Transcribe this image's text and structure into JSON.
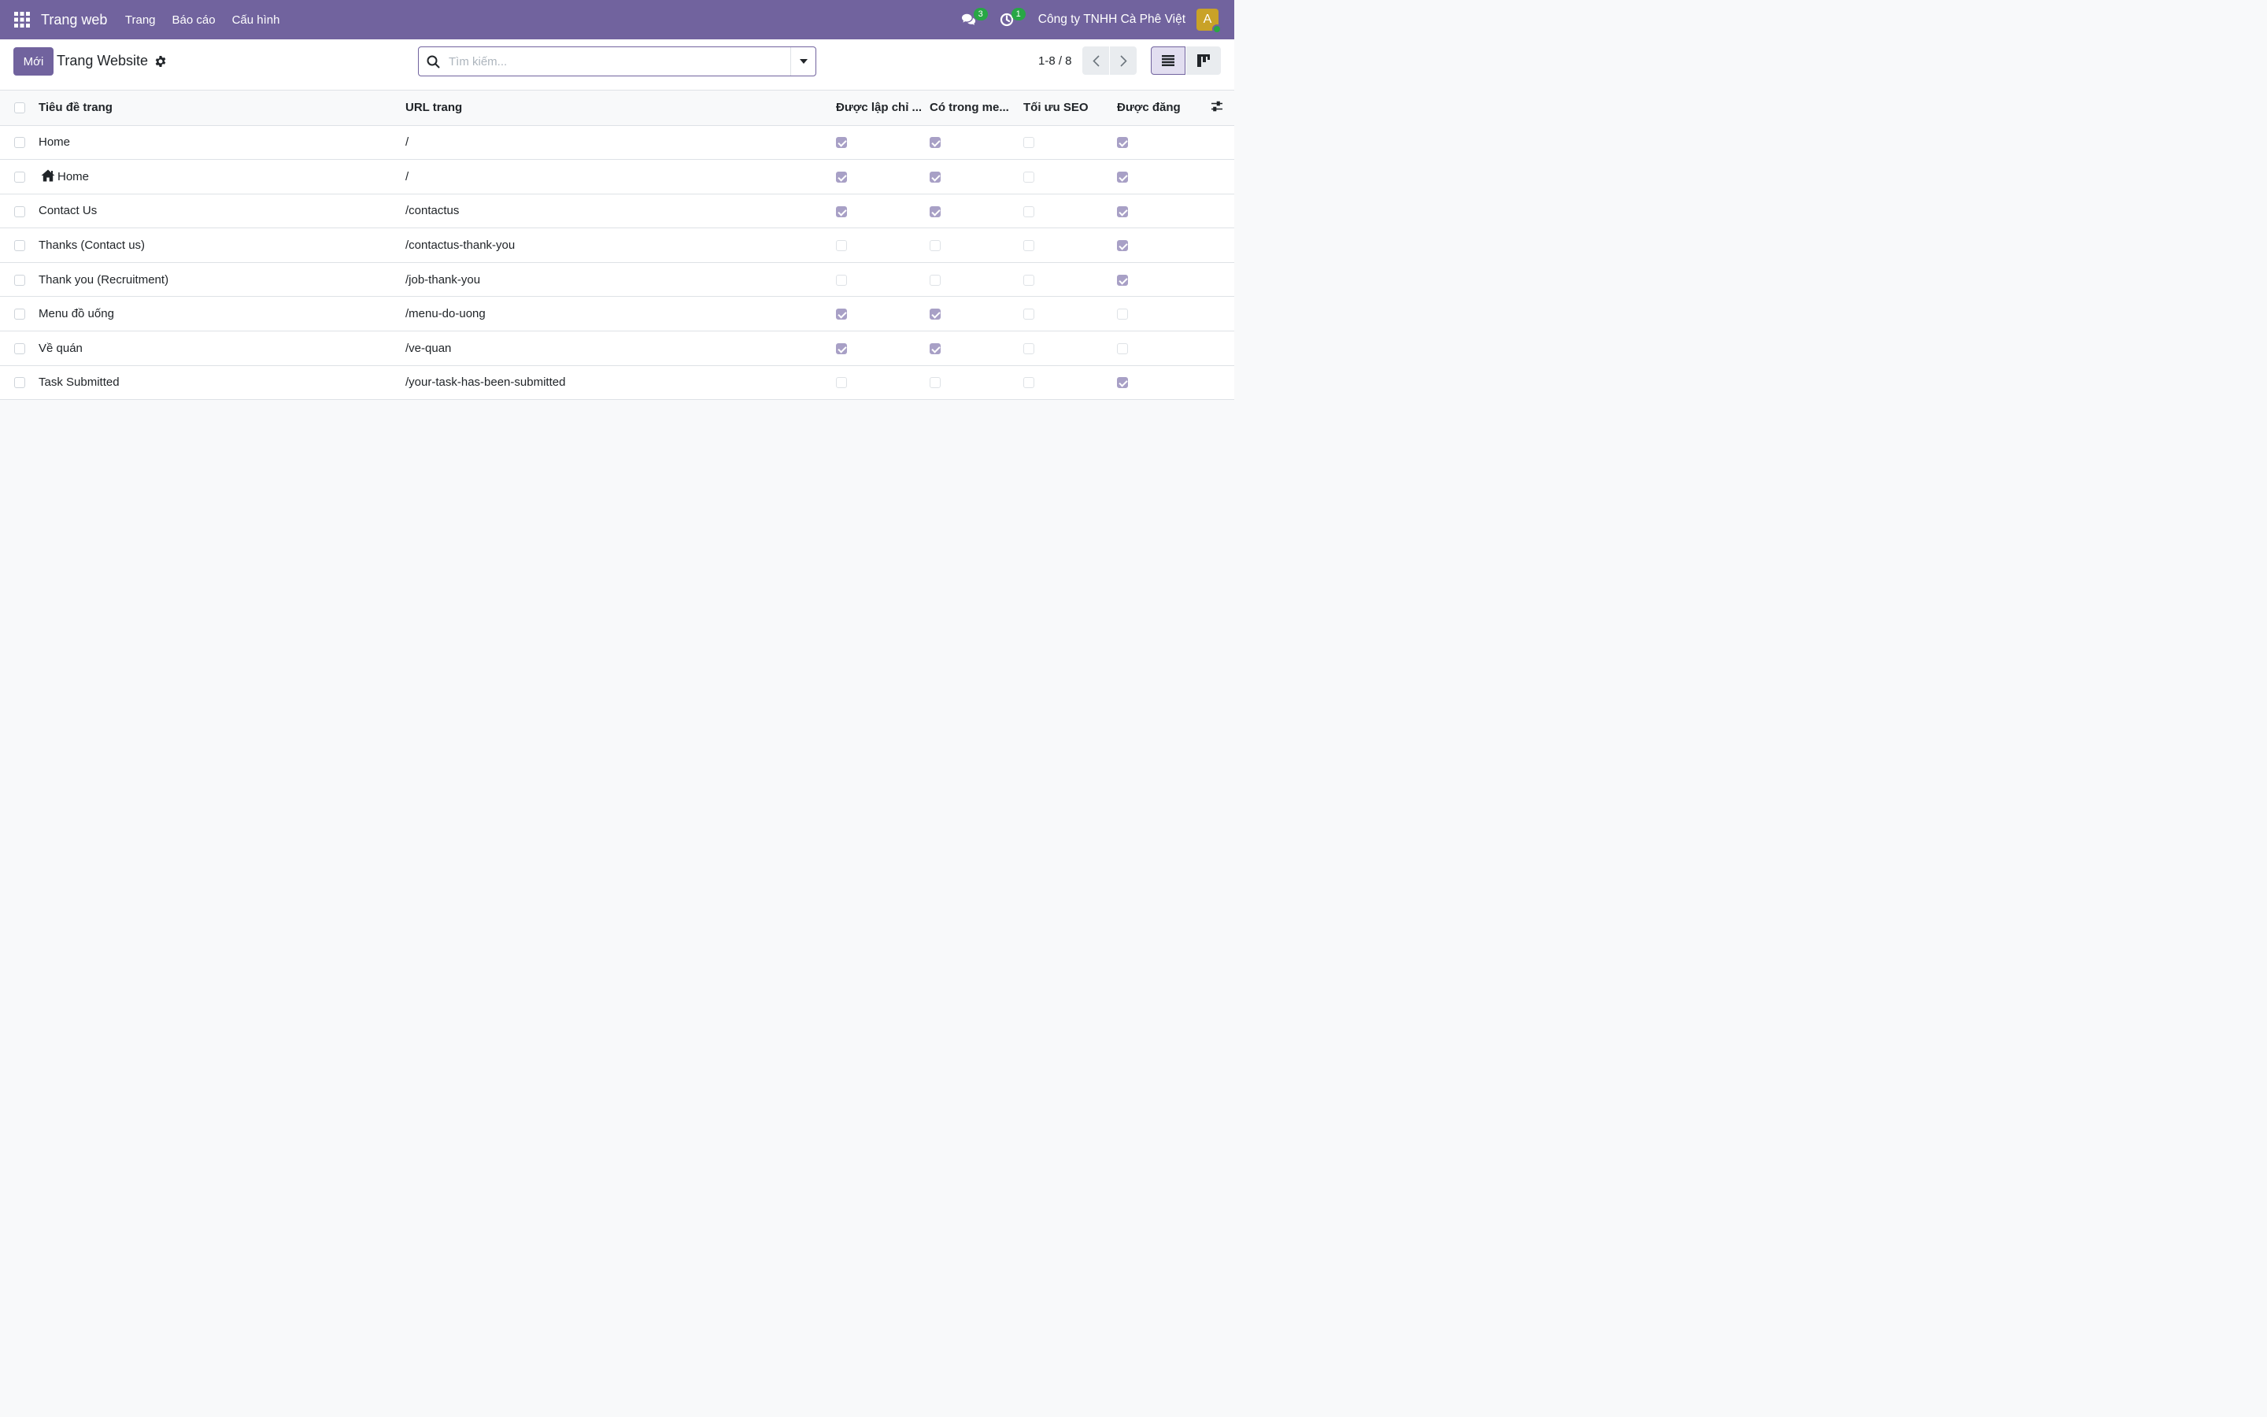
{
  "navbar": {
    "brand": "Trang web",
    "menu": [
      "Trang",
      "Báo cáo",
      "Cấu hình"
    ],
    "messages_count": "3",
    "activities_count": "1",
    "company": "Công ty TNHH Cà Phê Việt",
    "avatar_initial": "A",
    "accent": "#71639e"
  },
  "control_panel": {
    "new_label": "Mới",
    "title": "Trang Website",
    "search_placeholder": "Tìm kiếm...",
    "pager": "1-8 / 8"
  },
  "table": {
    "headers": {
      "title": "Tiêu đề trang",
      "url": "URL trang",
      "indexed": "Được lập chỉ ...",
      "in_menu": "Có trong me...",
      "seo": "Tối ưu SEO",
      "published": "Được đăng"
    },
    "rows": [
      {
        "title": "Home",
        "url": "/",
        "home_icon": false,
        "indexed": true,
        "in_menu": true,
        "seo": false,
        "published": true
      },
      {
        "title": "Home",
        "url": "/",
        "home_icon": true,
        "indexed": true,
        "in_menu": true,
        "seo": false,
        "published": true
      },
      {
        "title": "Contact Us",
        "url": "/contactus",
        "home_icon": false,
        "indexed": true,
        "in_menu": true,
        "seo": false,
        "published": true
      },
      {
        "title": "Thanks (Contact us)",
        "url": "/contactus-thank-you",
        "home_icon": false,
        "indexed": false,
        "in_menu": false,
        "seo": false,
        "published": true
      },
      {
        "title": "Thank you (Recruitment)",
        "url": "/job-thank-you",
        "home_icon": false,
        "indexed": false,
        "in_menu": false,
        "seo": false,
        "published": true
      },
      {
        "title": "Menu đồ uống",
        "url": "/menu-do-uong",
        "home_icon": false,
        "indexed": true,
        "in_menu": true,
        "seo": false,
        "published": false
      },
      {
        "title": "Về quán",
        "url": "/ve-quan",
        "home_icon": false,
        "indexed": true,
        "in_menu": true,
        "seo": false,
        "published": false
      },
      {
        "title": "Task Submitted",
        "url": "/your-task-has-been-submitted",
        "home_icon": false,
        "indexed": false,
        "in_menu": false,
        "seo": false,
        "published": true
      }
    ]
  }
}
